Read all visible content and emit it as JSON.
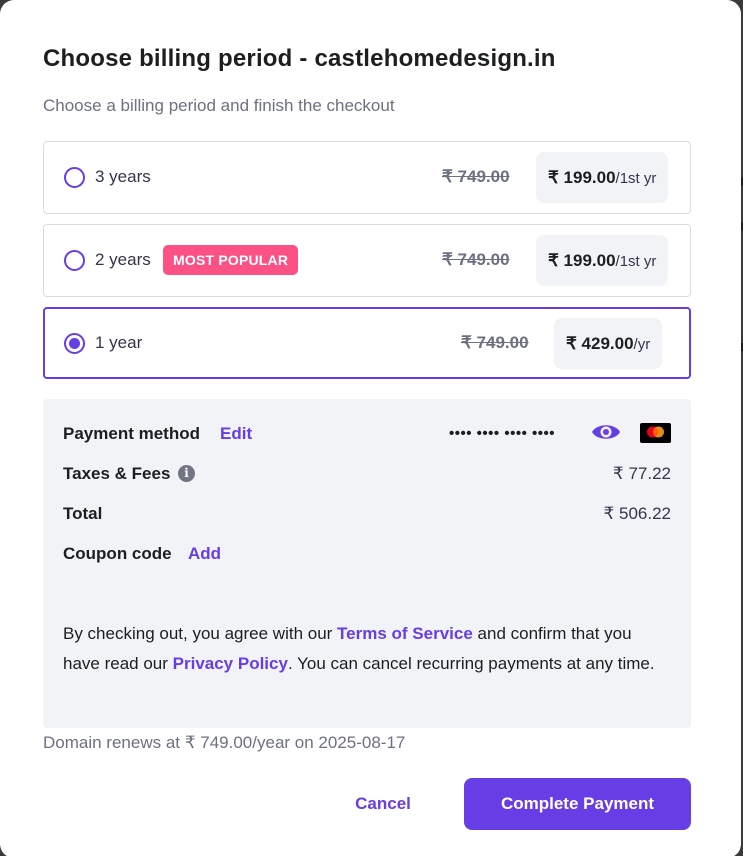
{
  "title": "Choose billing period - castlehomedesign.in",
  "subtitle": "Choose a billing period and finish the checkout",
  "options": [
    {
      "label": "3 years",
      "badge": "",
      "old_price": "₹ 749.00",
      "price": "₹ 199.00",
      "period": "/1st yr",
      "selected": false
    },
    {
      "label": "2 years",
      "badge": "MOST POPULAR",
      "old_price": "₹ 749.00",
      "price": "₹ 199.00",
      "period": "/1st yr",
      "selected": false
    },
    {
      "label": "1 year",
      "badge": "",
      "old_price": "₹ 749.00",
      "price": "₹ 429.00",
      "period": "/yr",
      "selected": true
    }
  ],
  "summary": {
    "payment_method_label": "Payment method",
    "edit_link": "Edit",
    "card_masked": "•••• •••• •••• ••••",
    "taxes_label": "Taxes & Fees",
    "taxes_value": "₹ 77.22",
    "total_label": "Total",
    "total_value": "₹ 506.22",
    "coupon_label": "Coupon code",
    "coupon_link": "Add",
    "legal_prefix": "By checking out, you agree with our ",
    "terms_link": "Terms of Service",
    "legal_middle": " and confirm that you have read our ",
    "privacy_link": "Privacy Policy",
    "legal_suffix": ". You can cancel recurring payments at any time."
  },
  "renew_note": "Domain renews at ₹ 749.00/year on 2025-08-17",
  "buttons": {
    "cancel": "Cancel",
    "complete": "Complete Payment"
  },
  "icons": {
    "info": "info-icon",
    "eye": "eye-icon",
    "card_brand": "mastercard-icon"
  },
  "colors": {
    "accent": "#673de6",
    "badge": "#fc5185"
  }
}
